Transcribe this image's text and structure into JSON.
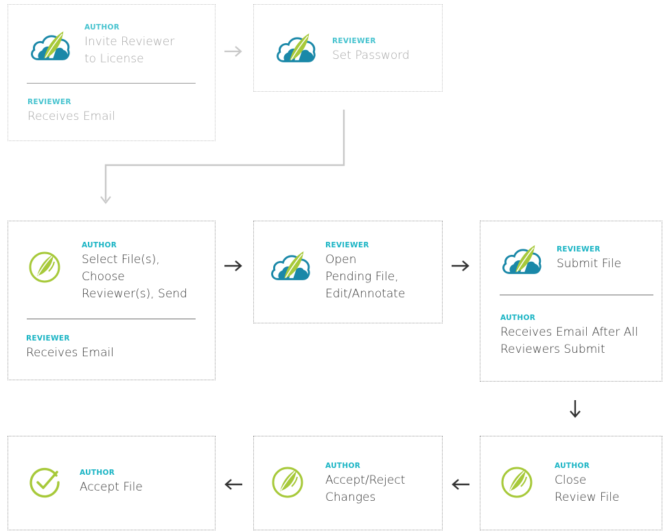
{
  "colors": {
    "role_teal": "#1ab4c4",
    "cloud_blue": "#1a88a8",
    "feather_green": "#a7c93a",
    "check_green": "#a7c93a",
    "text_dark": "#333333",
    "text_faded": "#a6a6a6",
    "arrow_dark": "#333333",
    "arrow_faded": "#c8c8c8"
  },
  "boxes": [
    {
      "id": "invite",
      "faded": true,
      "steps": [
        {
          "icon": "cloud-feather-icon",
          "role": "AUTHOR",
          "action": "Invite Reviewer\nto License"
        },
        {
          "role": "REVIEWER",
          "action": "Receives Email"
        }
      ]
    },
    {
      "id": "set-password",
      "faded": true,
      "steps": [
        {
          "icon": "cloud-feather-icon",
          "role": "REVIEWER",
          "action": "Set Password"
        }
      ]
    },
    {
      "id": "select-files",
      "faded": false,
      "steps": [
        {
          "icon": "feather-circle-icon",
          "role": "AUTHOR",
          "action": "Select File(s),\nChoose\nReviewer(s), Send"
        },
        {
          "role": "REVIEWER",
          "action": "Receives Email"
        }
      ]
    },
    {
      "id": "open-pending",
      "faded": false,
      "steps": [
        {
          "icon": "cloud-feather-icon",
          "role": "REVIEWER",
          "action": "Open\nPending File,\nEdit/Annotate"
        }
      ]
    },
    {
      "id": "submit-file",
      "faded": false,
      "steps": [
        {
          "icon": "cloud-feather-icon",
          "role": "REVIEWER",
          "action": "Submit File"
        },
        {
          "role": "AUTHOR",
          "action": "Receives Email After All\nReviewers Submit"
        }
      ]
    },
    {
      "id": "close-review",
      "faded": false,
      "steps": [
        {
          "icon": "feather-circle-icon",
          "role": "AUTHOR",
          "action": "Close\nReview File"
        }
      ]
    },
    {
      "id": "accept-reject",
      "faded": false,
      "steps": [
        {
          "icon": "feather-circle-icon",
          "role": "AUTHOR",
          "action": "Accept/Reject\nChanges"
        }
      ]
    },
    {
      "id": "accept-file",
      "faded": false,
      "steps": [
        {
          "icon": "check-circle-icon",
          "role": "AUTHOR",
          "action": "Accept File"
        }
      ]
    }
  ]
}
